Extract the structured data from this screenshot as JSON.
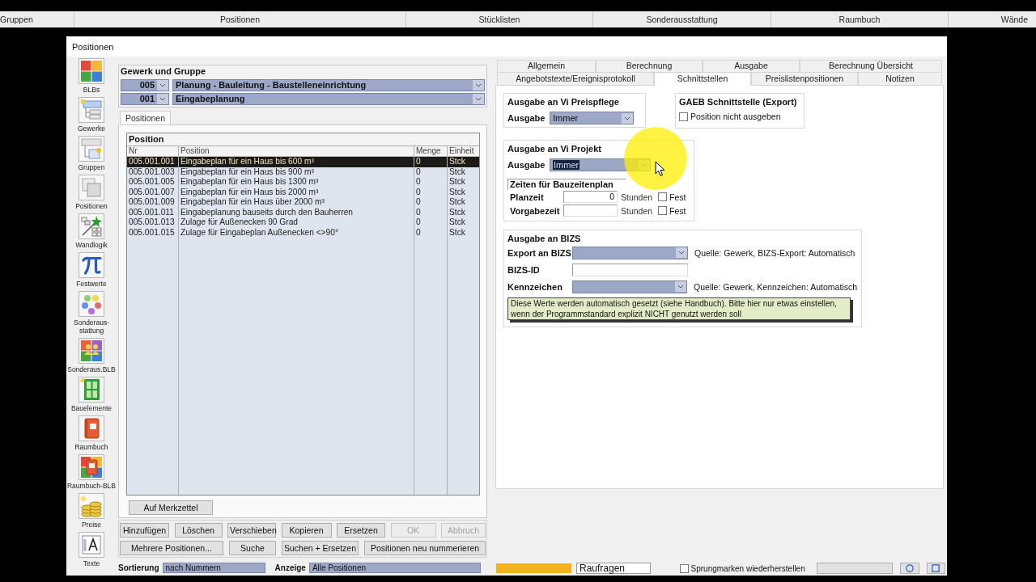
{
  "module_bar": {
    "items": [
      "Gruppen",
      "Positionen",
      "Stücklisten",
      "Sonderausstattung",
      "Raumbuch",
      "Wände"
    ]
  },
  "window": {
    "title": "Positionen"
  },
  "sidebar": {
    "items": [
      {
        "label": "BLBs",
        "kind": "tiles"
      },
      {
        "label": "Gewerke",
        "kind": "gewerke"
      },
      {
        "label": "Gruppen",
        "kind": "gruppen"
      },
      {
        "label": "Positionen",
        "kind": "pages"
      },
      {
        "label": "Wandlogik",
        "kind": "magic"
      },
      {
        "label": "Festwerte",
        "kind": "pi"
      },
      {
        "label": "Sonderaus-stattung",
        "kind": "dots"
      },
      {
        "label": "Sonderaus.BLB",
        "kind": "people"
      },
      {
        "label": "Bauelemente",
        "kind": "door"
      },
      {
        "label": "Raumbuch",
        "kind": "book"
      },
      {
        "label": "Raumbuch-BLB",
        "kind": "booktiles"
      },
      {
        "label": "Preise",
        "kind": "coins"
      },
      {
        "label": "Texte",
        "kind": "letter"
      }
    ]
  },
  "gewerk_gruppe": {
    "title": "Gewerk und Gruppe",
    "rows": [
      {
        "code": "005",
        "name": "Planung - Bauleitung - Baustelleneinrichtung"
      },
      {
        "code": "001",
        "name": "Eingabeplanung"
      }
    ]
  },
  "left_tabs": [
    {
      "label": "Positionen",
      "selected": true
    }
  ],
  "position_table": {
    "title": "Position",
    "columns": [
      "Nr",
      "Position",
      "Menge",
      "Einheit"
    ],
    "rows": [
      {
        "nr": "005.001.001",
        "position": "Eingabeplan für ein Haus bis 600 m³",
        "menge": "0",
        "einheit": "Stck",
        "selected": true
      },
      {
        "nr": "005.001.003",
        "position": "Eingabeplan für ein Haus bis 900 m³",
        "menge": "0",
        "einheit": "Stck",
        "selected": false
      },
      {
        "nr": "005.001.005",
        "position": "Eingabeplan für ein Haus bis 1300 m³",
        "menge": "0",
        "einheit": "Stck",
        "selected": false
      },
      {
        "nr": "005.001.007",
        "position": "Eingabeplan für ein Haus bis 2000 m³",
        "menge": "0",
        "einheit": "Stck",
        "selected": false
      },
      {
        "nr": "005.001.009",
        "position": "Eingabeplan für ein Haus über 2000 m³",
        "menge": "0",
        "einheit": "Stck",
        "selected": false
      },
      {
        "nr": "005.001.011",
        "position": "Eingabeplanung bauseits durch den Bauherren",
        "menge": "0",
        "einheit": "Stck",
        "selected": false
      },
      {
        "nr": "005.001.013",
        "position": "Zulage für Außenecken 90 Grad",
        "menge": "0",
        "einheit": "Stck",
        "selected": false
      },
      {
        "nr": "005.001.015",
        "position": "Zulage für Eingabeplan Außenecken <>90°",
        "menge": "0",
        "einheit": "Stck",
        "selected": false
      }
    ]
  },
  "merkzettel_button": {
    "label": "Auf Merkzettel"
  },
  "button_rows": [
    [
      {
        "label": "Hinzufügen",
        "disabled": false
      },
      {
        "label": "Löschen",
        "disabled": false
      },
      {
        "label": "Verschieben",
        "disabled": false
      },
      {
        "label": "Kopieren",
        "disabled": false
      },
      {
        "label": "Ersetzen",
        "disabled": false
      },
      {
        "label": "OK",
        "disabled": true
      },
      {
        "label": "Abbruch",
        "disabled": true
      }
    ],
    [
      {
        "label": "Mehrere Positionen...",
        "disabled": false
      },
      {
        "label": "Suche",
        "disabled": false
      },
      {
        "label": "Suchen + Ersetzen",
        "disabled": false
      },
      {
        "label": "Positionen neu nummerieren",
        "disabled": false
      }
    ]
  ],
  "bottom_left": {
    "sort_label": "Sortierung",
    "sort_value": "nach Nummern",
    "view_label": "Anzeige",
    "view_value": "Alle Positionen"
  },
  "detail_tabs": [
    [
      {
        "label": "Allgemein",
        "selected": false
      },
      {
        "label": "Berechnung",
        "selected": false
      },
      {
        "label": "Ausgabe",
        "selected": false
      },
      {
        "label": "Berechnung Übersicht",
        "selected": false
      }
    ],
    [
      {
        "label": "Angebotstexte/Ereignisprotokoll",
        "selected": false
      },
      {
        "label": "Schnittstellen",
        "selected": true
      },
      {
        "label": "Preislistenpositionen",
        "selected": false
      },
      {
        "label": "Notizen",
        "selected": false
      }
    ]
  ],
  "schnittstellen": {
    "preispflege": {
      "title": "Ausgabe an Vi Preispflege",
      "label": "Ausgabe",
      "value": "Immer"
    },
    "gaeb": {
      "title": "GAEB Schnittstelle (Export)",
      "checkbox": {
        "label": "Position nicht ausgeben",
        "checked": false
      }
    },
    "projekt": {
      "title": "Ausgabe an Vi Projekt",
      "label": "Ausgabe",
      "value": "Immer",
      "value_selected": true,
      "zeiten_title": "Zeiten für Bauzeitenplan",
      "rows": [
        {
          "label": "Planzeit",
          "value": "0",
          "unit": "Stunden",
          "fest": {
            "label": "Fest",
            "checked": false
          }
        },
        {
          "label": "Vorgabezeit",
          "unit": "Stunden",
          "fest": {
            "label": "Fest",
            "checked": false
          }
        }
      ]
    },
    "bizs": {
      "title": "Ausgabe an BIZS",
      "rows": [
        {
          "kind": "combo",
          "label": "Export an BIZS",
          "note": "Quelle: Gewerk, BIZS-Export: Automatisch"
        },
        {
          "kind": "input",
          "label": "BIZS-ID"
        },
        {
          "kind": "combo",
          "label": "Kennzeichen",
          "note": "Quelle: Gewerk, Kennzeichen: Automatisch"
        }
      ],
      "hint": "Diese Werte werden automatisch gesetzt (siehe Handbuch). Bitte hier nur etwas einstellen, wenn der Programmstandard explizit NICHT genutzt werden soll"
    }
  },
  "bottom_right": {
    "field_text": "Raufragen",
    "jump_checkbox": {
      "label": "Sprungmarken wiederherstellen",
      "checked": false
    }
  }
}
